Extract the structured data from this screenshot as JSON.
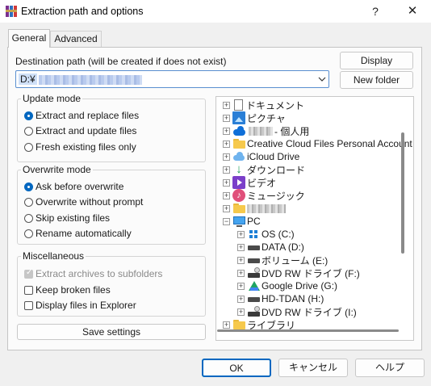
{
  "window": {
    "title": "Extraction path and options",
    "help_glyph": "?",
    "close_glyph": "✕"
  },
  "tabs": [
    {
      "label": "General"
    },
    {
      "label": "Advanced"
    }
  ],
  "destination": {
    "label": "Destination path (will be created if does not exist)",
    "path_prefix": "D:¥"
  },
  "buttons": {
    "display": "Display",
    "new_folder": "New folder",
    "save_settings": "Save settings",
    "ok": "OK",
    "cancel": "キャンセル",
    "help": "ヘルプ"
  },
  "update_mode": {
    "title": "Update mode",
    "options": [
      {
        "label": "Extract and replace files",
        "selected": true
      },
      {
        "label": "Extract and update files",
        "selected": false
      },
      {
        "label": "Fresh existing files only",
        "selected": false
      }
    ]
  },
  "overwrite_mode": {
    "title": "Overwrite mode",
    "options": [
      {
        "label": "Ask before overwrite",
        "selected": true
      },
      {
        "label": "Overwrite without prompt",
        "selected": false
      },
      {
        "label": "Skip existing files",
        "selected": false
      },
      {
        "label": "Rename automatically",
        "selected": false
      }
    ]
  },
  "miscellaneous": {
    "title": "Miscellaneous",
    "options": [
      {
        "label": "Extract archives to subfolders",
        "checked": true,
        "disabled": true
      },
      {
        "label": "Keep broken files",
        "checked": false,
        "disabled": false
      },
      {
        "label": "Display files in Explorer",
        "checked": false,
        "disabled": false
      }
    ]
  },
  "tree": {
    "nodes": [
      {
        "label": "ドキュメント",
        "icon": "document-icon"
      },
      {
        "label": "ピクチャ",
        "icon": "pictures-icon"
      },
      {
        "label": "- 個人用",
        "icon": "onedrive-icon"
      },
      {
        "label": "Creative Cloud Files Personal Account",
        "icon": "folder-icon"
      },
      {
        "label": "iCloud Drive",
        "icon": "icloud-icon"
      },
      {
        "label": "ダウンロード",
        "icon": "download-icon"
      },
      {
        "label": "ビデオ",
        "icon": "video-icon"
      },
      {
        "label": "ミュージック",
        "icon": "music-icon"
      },
      {
        "label": "",
        "icon": "folder-icon"
      },
      {
        "label": "PC",
        "icon": "pc-icon"
      },
      {
        "label": "OS (C:)",
        "icon": "windows-drive-icon"
      },
      {
        "label": "DATA (D:)",
        "icon": "drive-icon"
      },
      {
        "label": "ボリューム (E:)",
        "icon": "drive-icon"
      },
      {
        "label": "DVD RW ドライブ (F:)",
        "icon": "dvd-icon"
      },
      {
        "label": "Google Drive (G:)",
        "icon": "google-drive-icon"
      },
      {
        "label": "HD-TDAN (H:)",
        "icon": "drive-icon"
      },
      {
        "label": "DVD RW ドライブ (I:)",
        "icon": "dvd-icon"
      },
      {
        "label": "ライブラリ",
        "icon": "folder-icon"
      }
    ]
  }
}
